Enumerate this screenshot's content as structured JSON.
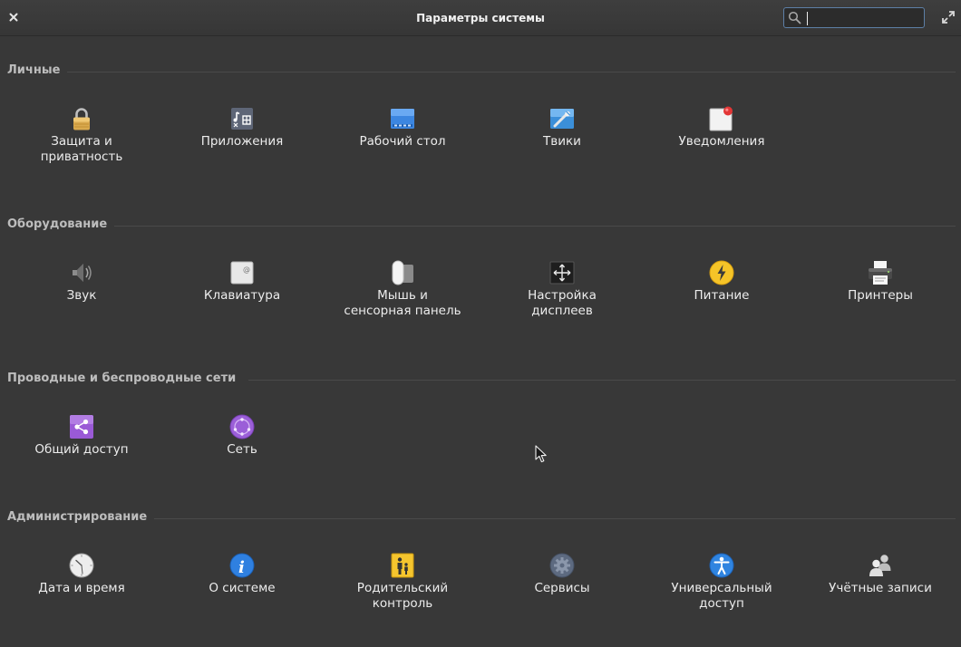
{
  "window": {
    "title": "Параметры системы",
    "search_placeholder": "",
    "search_value": ""
  },
  "sections": [
    {
      "header": "Личные",
      "items": [
        {
          "label": "Защита и\nприватность",
          "icon": "lock-icon"
        },
        {
          "label": "Приложения",
          "icon": "applications-icon"
        },
        {
          "label": "Рабочий стол",
          "icon": "desktop-icon"
        },
        {
          "label": "Твики",
          "icon": "tweaks-icon"
        },
        {
          "label": "Уведомления",
          "icon": "notifications-icon"
        }
      ]
    },
    {
      "header": "Оборудование",
      "items": [
        {
          "label": "Звук",
          "icon": "speaker-icon"
        },
        {
          "label": "Клавиатура",
          "icon": "keyboard-icon"
        },
        {
          "label": "Мышь и\nсенсорная панель",
          "icon": "mouse-icon"
        },
        {
          "label": "Настройка\nдисплеев",
          "icon": "display-icon"
        },
        {
          "label": "Питание",
          "icon": "power-icon"
        },
        {
          "label": "Принтеры",
          "icon": "printer-icon"
        }
      ]
    },
    {
      "header": "Проводные и беспроводные сети",
      "items": [
        {
          "label": "Общий доступ",
          "icon": "sharing-icon"
        },
        {
          "label": "Сеть",
          "icon": "network-icon"
        }
      ]
    },
    {
      "header": "Администрирование",
      "items": [
        {
          "label": "Дата и время",
          "icon": "clock-icon"
        },
        {
          "label": "О системе",
          "icon": "info-icon"
        },
        {
          "label": "Родительский\nконтроль",
          "icon": "parental-control-icon"
        },
        {
          "label": "Сервисы",
          "icon": "services-gear-icon"
        },
        {
          "label": "Универсальный\nдоступ",
          "icon": "accessibility-icon"
        },
        {
          "label": "Учётные записи",
          "icon": "user-accounts-icon"
        }
      ]
    }
  ]
}
